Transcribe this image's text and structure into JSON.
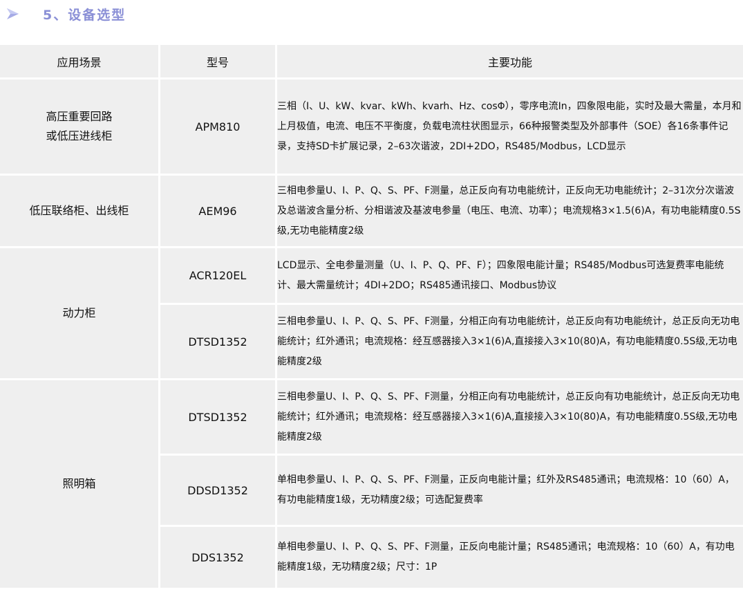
{
  "section": {
    "title": "5、设备选型",
    "icon": "triangle-arrow-icon"
  },
  "table": {
    "headers": [
      "应用场景",
      "型号",
      "主要功能"
    ],
    "groups": [
      {
        "scene": [
          "高压重要回路",
          "或低压进线柜"
        ],
        "rows": [
          {
            "model": "APM810",
            "func": "三相（I、U、kW、kvar、kWh、kvarh、Hz、cosΦ），零序电流In，四象限电能，实时及最大需量，本月和上月极值，电流、电压不平衡度，负载电流柱状图显示，66种报警类型及外部事件（SOE）各16条事件记录，支持SD卡扩展记录，2–63次谐波，2DI+2DO，RS485/Modbus，LCD显示"
          }
        ]
      },
      {
        "scene": [
          "低压联络柜、出线柜"
        ],
        "rows": [
          {
            "model": "AEM96",
            "func": "三相电参量U、I、P、Q、S、PF、F测量，总正反向有功电能统计，正反向无功电能统计；2–31次分次谐波及总谐波含量分析、分相谐波及基波电参量（电压、电流、功率）；电流规格3×1.5(6)A，有功电能精度0.5S级,无功电能精度2级"
          }
        ]
      },
      {
        "scene": [
          "动力柜"
        ],
        "rows": [
          {
            "model": "ACR120EL",
            "func": "LCD显示、全电参量测量（U、I、P、Q、PF、F）；四象限电能计量；RS485/Modbus可选复费率电能统计、最大需量统计；4DI+2DO；RS485通讯接口、Modbus协议"
          },
          {
            "model": "DTSD1352",
            "func": "三相电参量U、I、P、Q、S、PF、F测量，分相正向有功电能统计，总正反向有功电能统计，总正反向无功电能统计；红外通讯；电流规格：经互感器接入3×1(6)A,直接接入3×10(80)A，有功电能精度0.5S级,无功电能精度2级"
          }
        ]
      },
      {
        "scene": [
          "照明箱"
        ],
        "rows": [
          {
            "model": "DTSD1352",
            "func": "三相电参量U、I、P、Q、S、PF、F测量，分相正向有功电能统计，总正反向有功电能统计，总正反向无功电能统计；红外通讯；电流规格：经互感器接入3×1(6)A,直接接入3×10(80)A，有功电能精度0.5S级,无功电能精度2级"
          },
          {
            "model": "DDSD1352",
            "func": "单相电参量U、I、P、Q、S、PF、F测量，正反向电能计量；红外及RS485通讯；电流规格：10（60）A，有功电能精度1级，无功精度2级；可选配复费率"
          },
          {
            "model": "DDS1352",
            "func": "单相电参量U、I、P、Q、S、PF、F测量，正反向电能计量；RS485通讯；电流规格：10（60）A，有功电能精度1级，无功精度2级；尺寸：1P"
          }
        ]
      }
    ]
  }
}
